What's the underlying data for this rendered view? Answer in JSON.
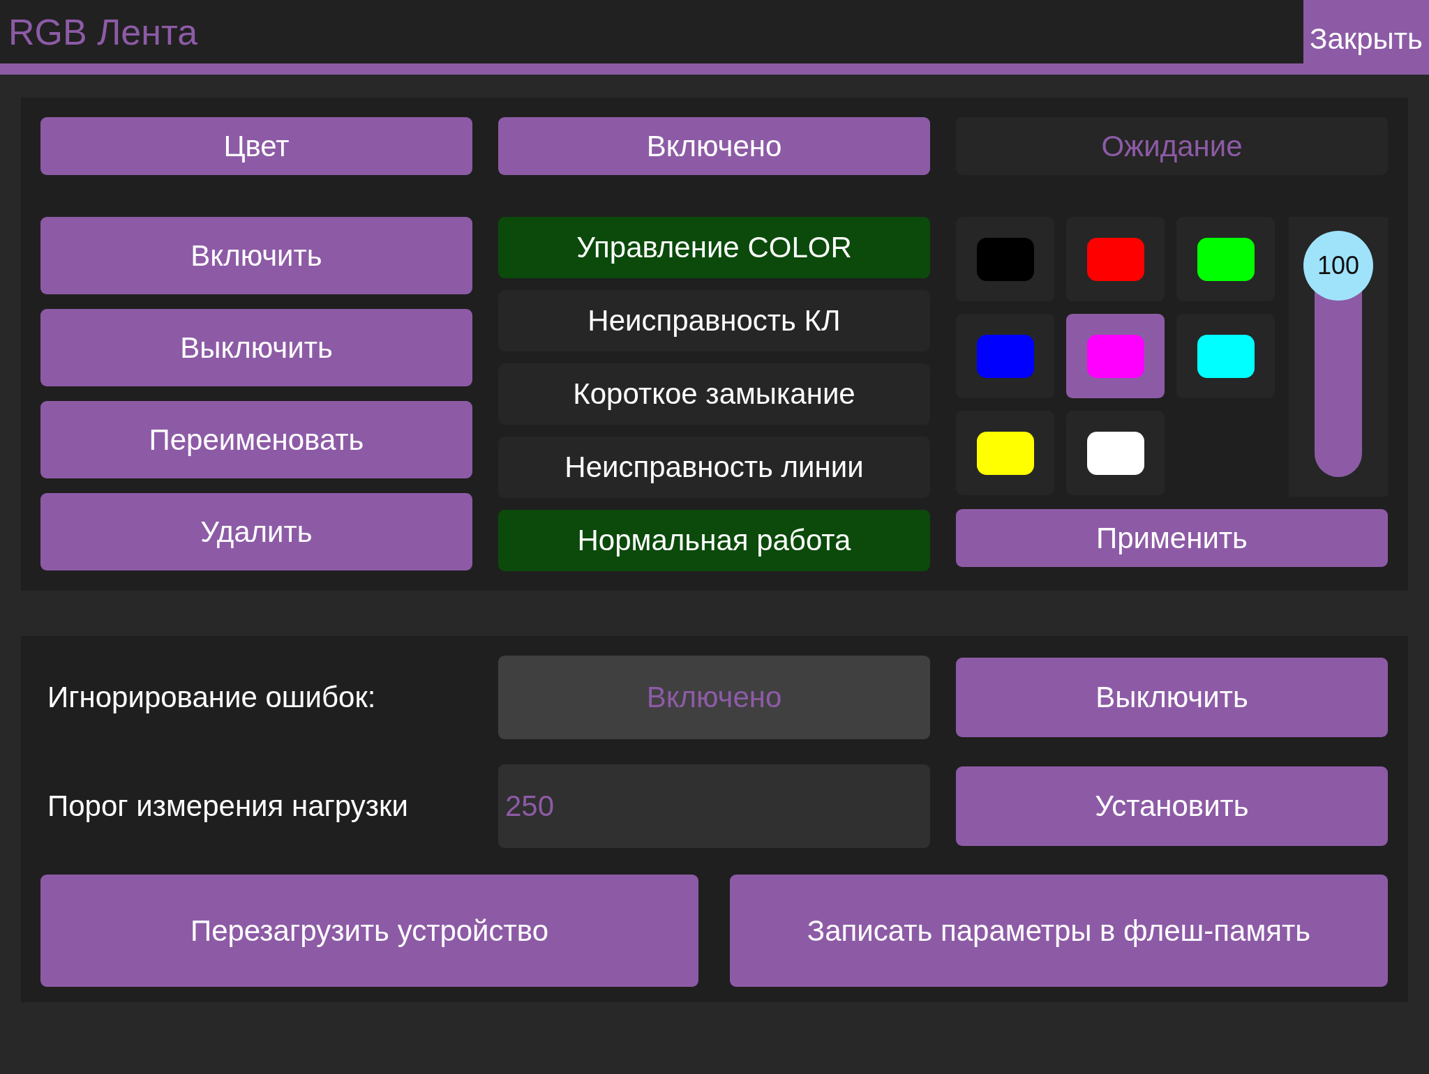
{
  "header": {
    "title": "RGB Лента",
    "close_button": "Закрыть"
  },
  "top_row": {
    "color_button": "Цвет",
    "state_button": "Включено",
    "status": "Ожидание"
  },
  "actions": [
    "Включить",
    "Выключить",
    "Переименовать",
    "Удалить"
  ],
  "indicators": [
    {
      "label": "Управление COLOR",
      "on": true
    },
    {
      "label": "Неисправность КЛ",
      "on": false
    },
    {
      "label": "Короткое замыкание",
      "on": false
    },
    {
      "label": "Неисправность линии",
      "on": false
    },
    {
      "label": "Нормальная работа",
      "on": true
    }
  ],
  "swatches": [
    {
      "color": "#000000",
      "selected": false
    },
    {
      "color": "#ff0000",
      "selected": false
    },
    {
      "color": "#00ff00",
      "selected": false
    },
    {
      "color": "#0000ff",
      "selected": false
    },
    {
      "color": "#ff00ff",
      "selected": true
    },
    {
      "color": "#00ffff",
      "selected": false
    },
    {
      "color": "#ffff00",
      "selected": false
    },
    {
      "color": "#ffffff",
      "selected": false
    }
  ],
  "brightness": {
    "level": 1,
    "reading": "100"
  },
  "apply_button": "Применить",
  "settings": {
    "ignore_errors": {
      "label": "Игнорирование ошибок:",
      "state": "Включено",
      "button": "Выключить"
    },
    "threshold": {
      "label": "Порог измерения нагрузки",
      "value": "250",
      "button": "Установить"
    }
  },
  "bottom_buttons": [
    "Перезагрузить устройство",
    "Записать параметры в флеш-память"
  ]
}
